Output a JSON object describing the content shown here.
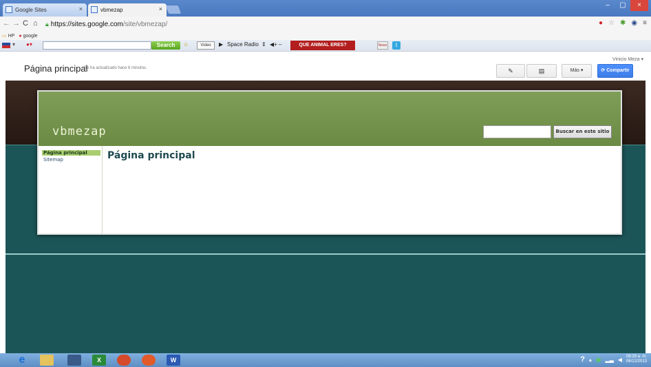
{
  "browser": {
    "tabs": [
      {
        "label": "Google Sites",
        "close": "×"
      },
      {
        "label": "vbmezap",
        "close": "×"
      }
    ],
    "window_buttons": {
      "minimize": "–",
      "maximize": "▢",
      "close": "×"
    },
    "address": {
      "host": "https://sites.google.com",
      "path": "/site/vbmezap/"
    },
    "bookmarks": [
      {
        "label": "HP"
      },
      {
        "label": "google"
      }
    ]
  },
  "toolbar": {
    "search_button": "Search",
    "video_label": "Video",
    "radio_label": "Space Radio",
    "volume_label": "◀+ –",
    "animal_banner": "QUE ANIMAL ERES?",
    "news_label": "News"
  },
  "sites_header": {
    "page_title": "Página principal",
    "updated_text": "Se ha actualizado hace 6 minutos.",
    "user_name": "Vinicio Meza ▾",
    "more_label": "Más ▾",
    "share_label": "Compartir"
  },
  "site": {
    "name": "vbmezap",
    "search_button": "Buscar en este sitio",
    "nav_items": [
      {
        "label": "Página principal",
        "active": true
      },
      {
        "label": "Sitemap",
        "active": false
      }
    ],
    "content_title": "Página principal"
  },
  "taskbar": {
    "time": "08:29 a. m.",
    "date": "06/12/2013"
  },
  "colors": {
    "header_green": "#7f9e58",
    "nav_active": "#a9cd6f",
    "site_teal": "#1c5558",
    "share_blue": "#4d90fe"
  }
}
